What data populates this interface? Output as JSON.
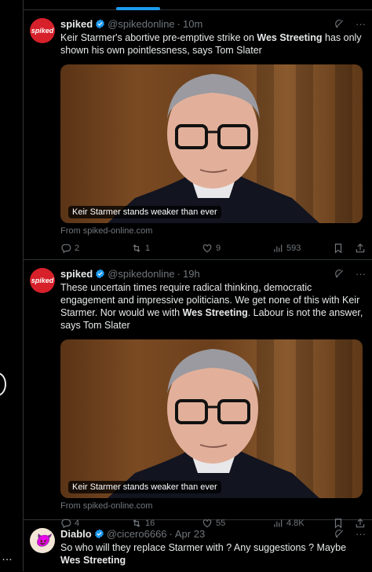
{
  "rail": {
    "more": "…"
  },
  "tweets": [
    {
      "avatar_text": "spiked",
      "name": "spiked",
      "handle": "@spikedonline",
      "time": "10m",
      "text_parts": [
        "Keir Starmer's abortive pre-emptive strike on ",
        "Wes Streeting",
        " has only shown his own pointlessness, says Tom Slater"
      ],
      "caption": "Keir Starmer stands weaker than ever",
      "source": "From spiked-online.com",
      "replies": "2",
      "reposts": "1",
      "likes": "9",
      "views": "593"
    },
    {
      "avatar_text": "spiked",
      "name": "spiked",
      "handle": "@spikedonline",
      "time": "19h",
      "text_parts": [
        "These uncertain times require radical thinking, democratic engagement and impressive politicians. We get none of this with Keir Starmer. Nor would we with ",
        "Wes Streeting",
        ". Labour is not the answer, says Tom Slater"
      ],
      "caption": "Keir Starmer stands weaker than ever",
      "source": "From spiked-online.com",
      "replies": "4",
      "reposts": "16",
      "likes": "55",
      "views": "4.8K"
    },
    {
      "avatar_text": "😈",
      "name": "Diablo",
      "handle": "@cicero6666",
      "time": "Apr 23",
      "text_parts": [
        "So who will they replace Starmer with ? Any suggestions ?  Maybe ",
        "Wes Streeting",
        ""
      ]
    }
  ],
  "dot": "·",
  "more_glyph": "···",
  "colors": {
    "accent": "#1d9bf0",
    "muted": "#71767b",
    "brand_red": "#d6202a"
  }
}
